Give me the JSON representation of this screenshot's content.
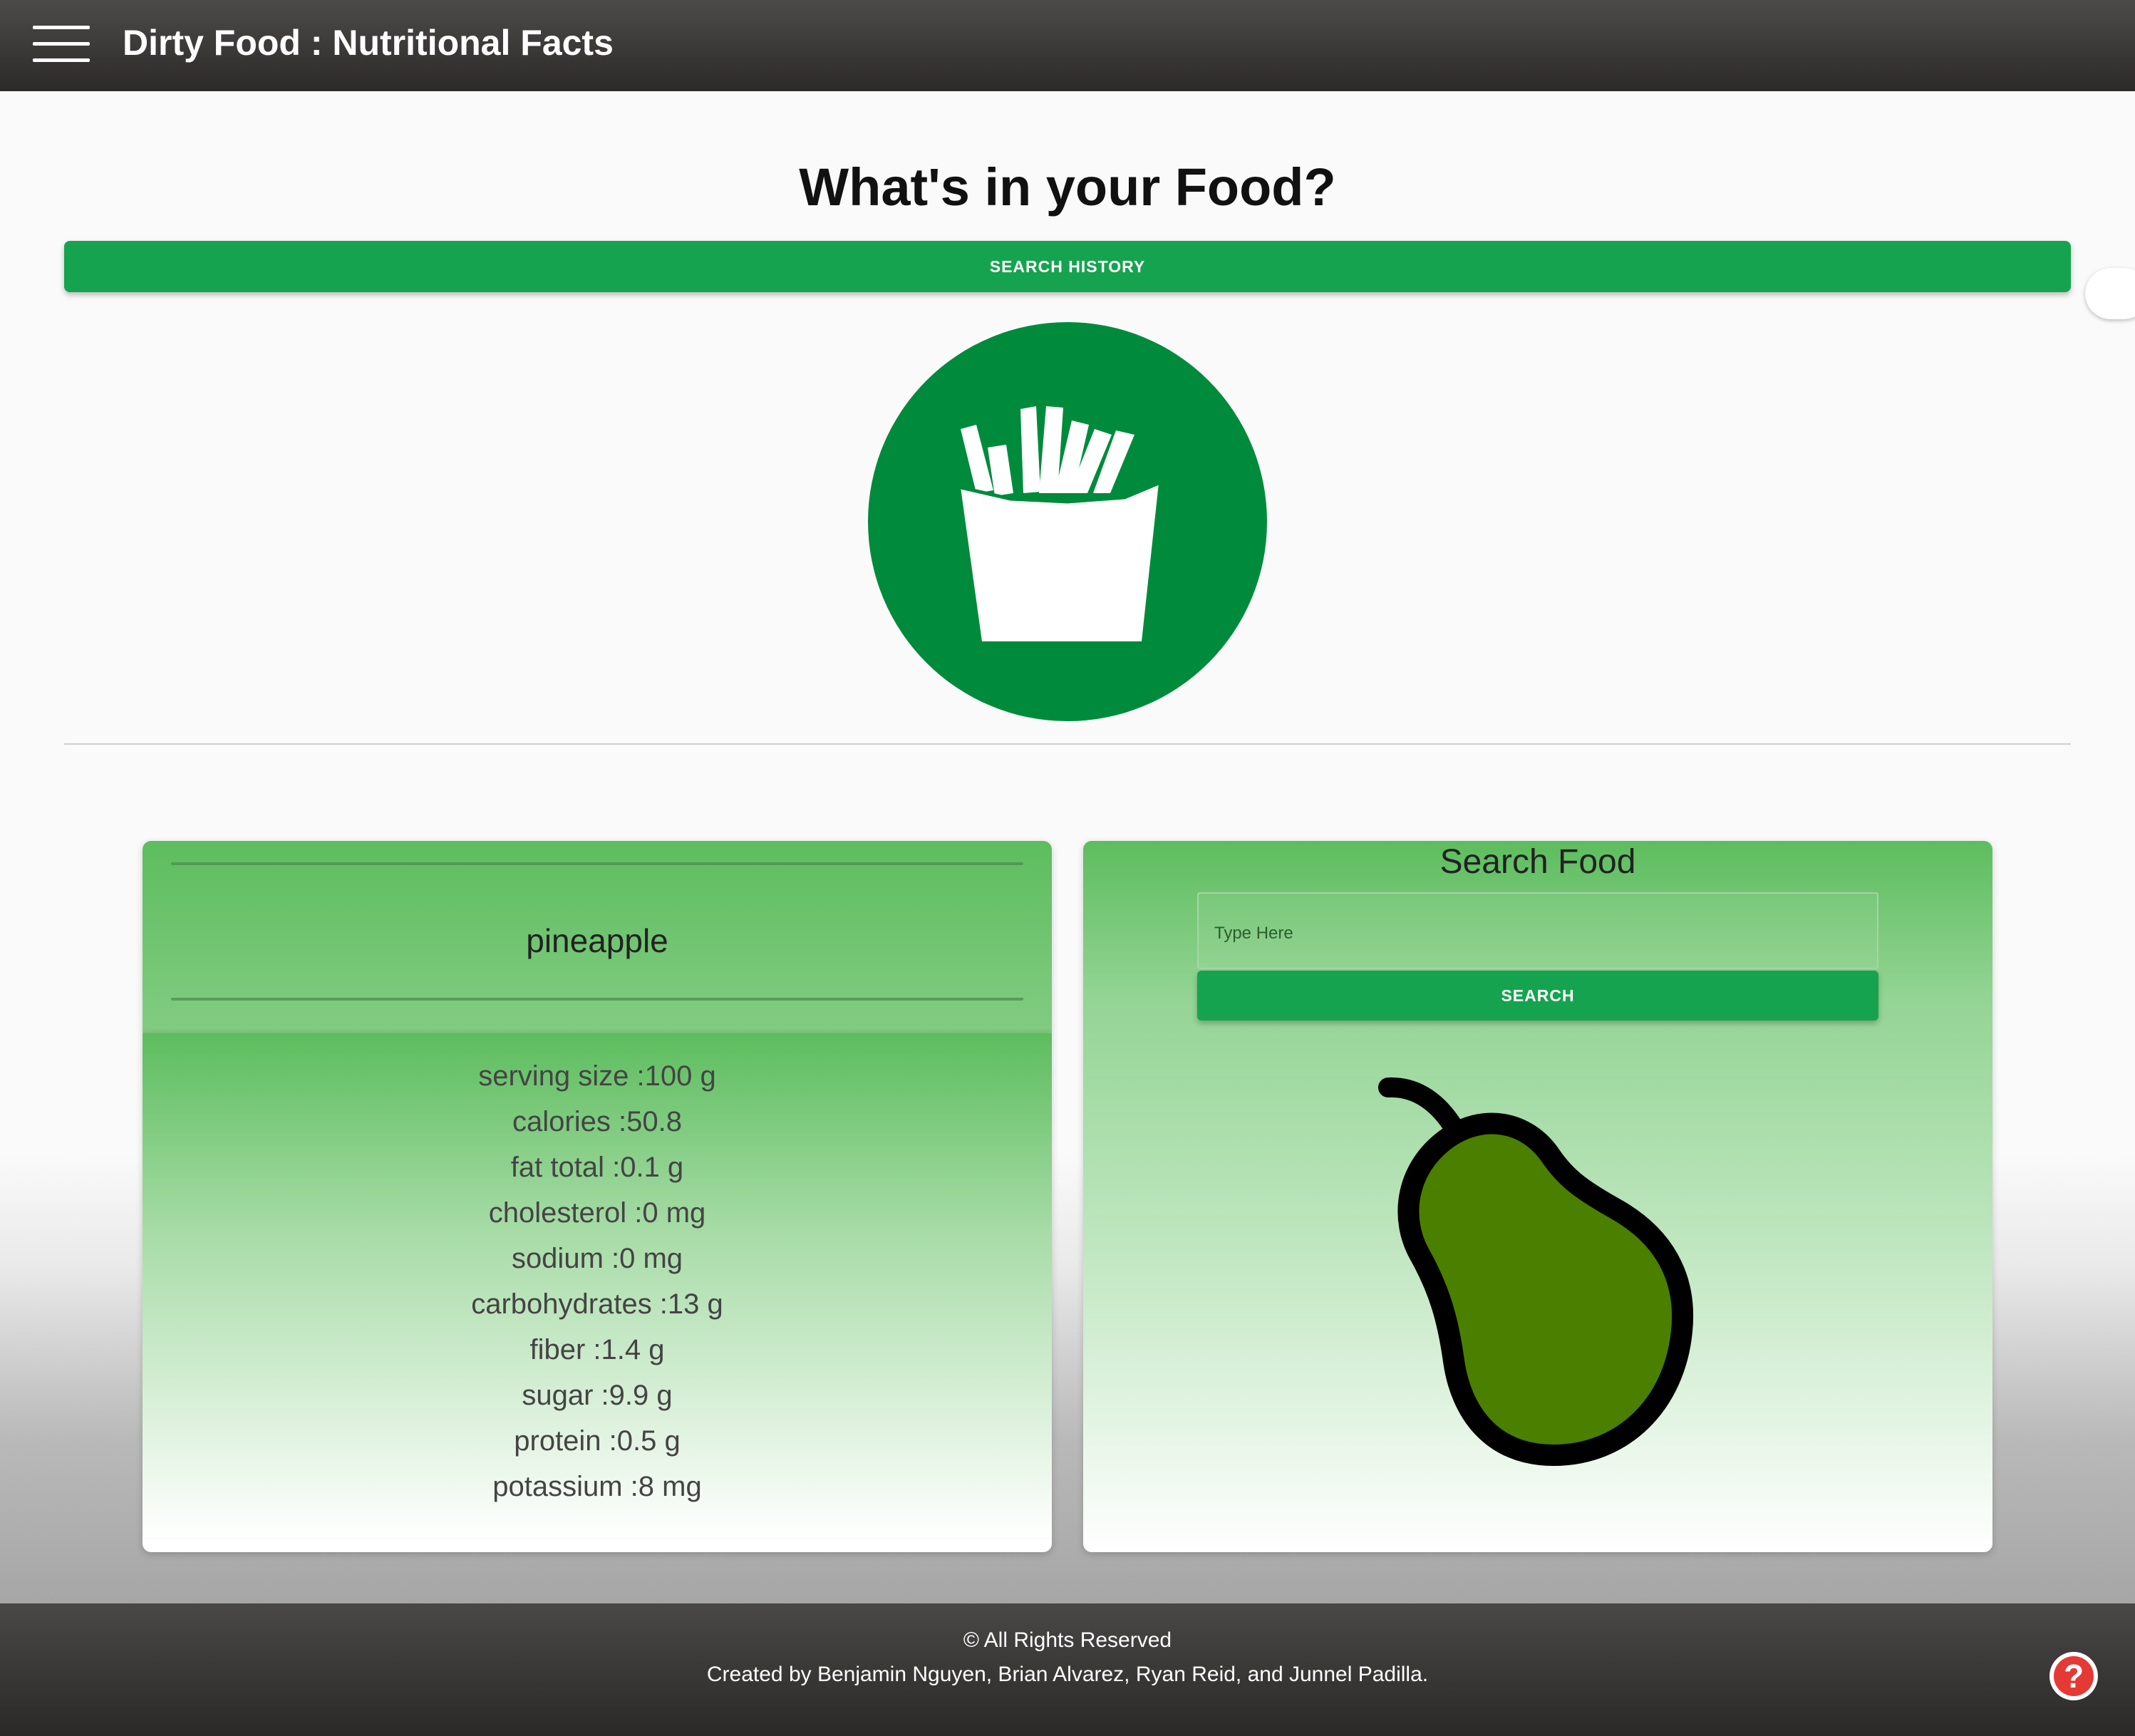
{
  "header": {
    "title": "Dirty Food : Nutritional Facts",
    "menu_icon": "hamburger-menu-icon"
  },
  "main": {
    "heading": "What's in your Food?",
    "history_button": "SEARCH HISTORY",
    "logo_icon": "french-fries-icon"
  },
  "result": {
    "food_name": "pineapple",
    "nutrients": [
      "serving size :100 g",
      "calories :50.8",
      "fat total :0.1 g",
      "cholesterol :0 mg",
      "sodium :0 mg",
      "carbohydrates :13 g",
      "fiber :1.4 g",
      "sugar :9.9 g",
      "protein :0.5 g",
      "potassium :8 mg"
    ]
  },
  "search": {
    "title": "Search Food",
    "placeholder": "Type Here",
    "button": "SEARCH",
    "illustration_icon": "pear-icon"
  },
  "footer": {
    "rights": "© All Rights Reserved",
    "credits": "Created by Benjamin Nguyen, Brian Alvarez, Ryan Reid, and Junnel Padilla."
  },
  "help": {
    "icon": "question-mark-icon",
    "glyph": "?"
  },
  "colors": {
    "accent_green": "#16a34f",
    "logo_green": "#008b3c",
    "pear_fill": "#4a7f00",
    "help_red": "#e53935"
  }
}
